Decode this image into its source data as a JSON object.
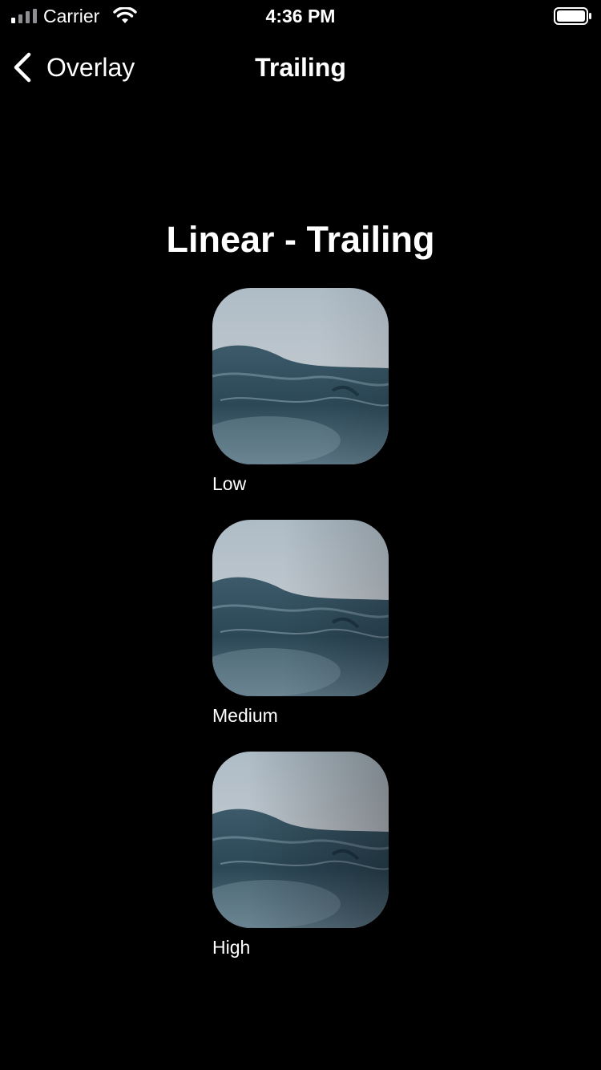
{
  "status_bar": {
    "carrier": "Carrier",
    "time": "4:36 PM",
    "icons": [
      "signal-icon",
      "wifi-icon",
      "battery-icon"
    ]
  },
  "nav": {
    "back_label": "Overlay",
    "back_icon": "chevron-left-icon",
    "title": "Trailing"
  },
  "section": {
    "title": "Linear - Trailing"
  },
  "items": [
    {
      "label": "Low",
      "image": "ocean-wave-image"
    },
    {
      "label": "Medium",
      "image": "ocean-wave-image"
    },
    {
      "label": "High",
      "image": "ocean-wave-image"
    }
  ],
  "colors": {
    "background": "#000000",
    "text": "#ffffff"
  }
}
